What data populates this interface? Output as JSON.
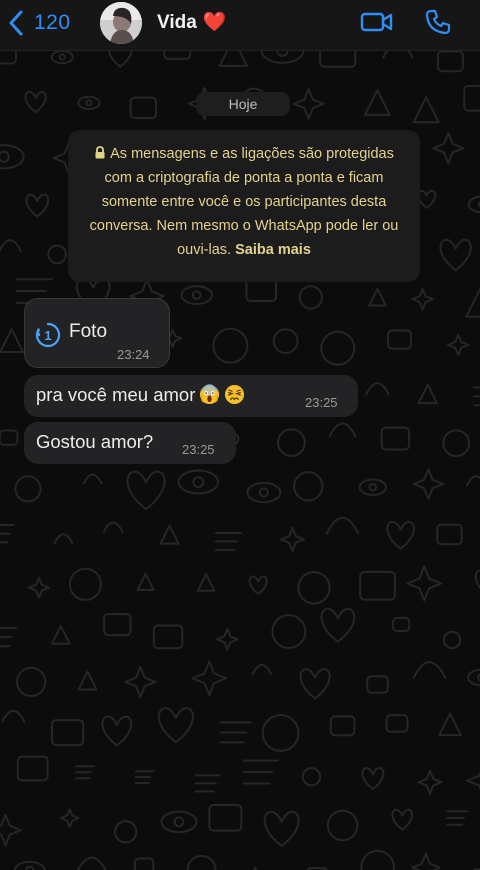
{
  "header": {
    "back_count": "120",
    "contact_name": "Vida",
    "contact_emoji": "❤️",
    "accent_color": "#2f8df6"
  },
  "date_chip": "Hoje",
  "encryption_notice": {
    "text": "As mensagens e as ligações são protegidas com a criptografia de ponta a ponta e ficam somente entre você e os participantes desta conversa. Nem mesmo o WhatsApp pode ler ou ouvi-las.",
    "link": "Saiba mais",
    "text_color": "#e4d38d"
  },
  "messages": [
    {
      "type": "view-once-photo",
      "label": "Foto",
      "time": "23:24"
    },
    {
      "type": "text",
      "text": "pra você meu amor",
      "emojis": [
        "😱",
        "😣"
      ],
      "time": "23:25"
    },
    {
      "type": "text",
      "text": "Gostou amor?",
      "time": "23:25"
    }
  ],
  "icons": {
    "back": "chevron-left-icon",
    "video": "video-camera-icon",
    "call": "phone-icon",
    "lock": "lock-icon",
    "view_once": "view-once-icon"
  }
}
